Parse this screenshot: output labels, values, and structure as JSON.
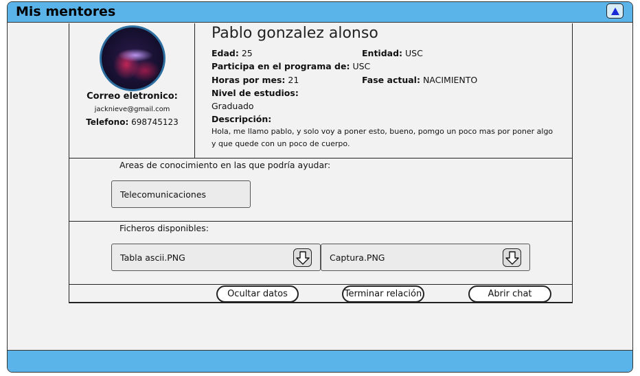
{
  "window": {
    "title": "Mis mentores"
  },
  "profile": {
    "name": "Pablo gonzalez alonso",
    "email_label": "Correo eletronico:",
    "email": "jacknieve@gmail.com",
    "phone_label": "Telefono:",
    "phone": "698745123",
    "age_label": "Edad:",
    "age": "25",
    "entity_label": "Entidad:",
    "entity": "USC",
    "program_label": "Participa en el programa de:",
    "program": "USC",
    "hours_label": "Horas por mes:",
    "hours": "21",
    "phase_label": "Fase actual:",
    "phase": "NACIMIENTO",
    "education_label": "Nivel de estudios:",
    "education": "Graduado",
    "description_label": "Descripción:",
    "description": "Hola, me llamo pablo, y solo voy a poner esto, bueno, pomgo un poco mas por poner algo y que quede con un poco de cuerpo."
  },
  "knowledge": {
    "title": "Areas de conocimiento en las que podría ayudar:",
    "items": [
      "Telecomunicaciones"
    ]
  },
  "files": {
    "title": "Ficheros disponibles:",
    "items": [
      "Tabla ascii.PNG",
      "Captura.PNG"
    ]
  },
  "actions": {
    "hide": "Ocultar datos",
    "end": "Terminar relación",
    "chat": "Abrir chat"
  }
}
